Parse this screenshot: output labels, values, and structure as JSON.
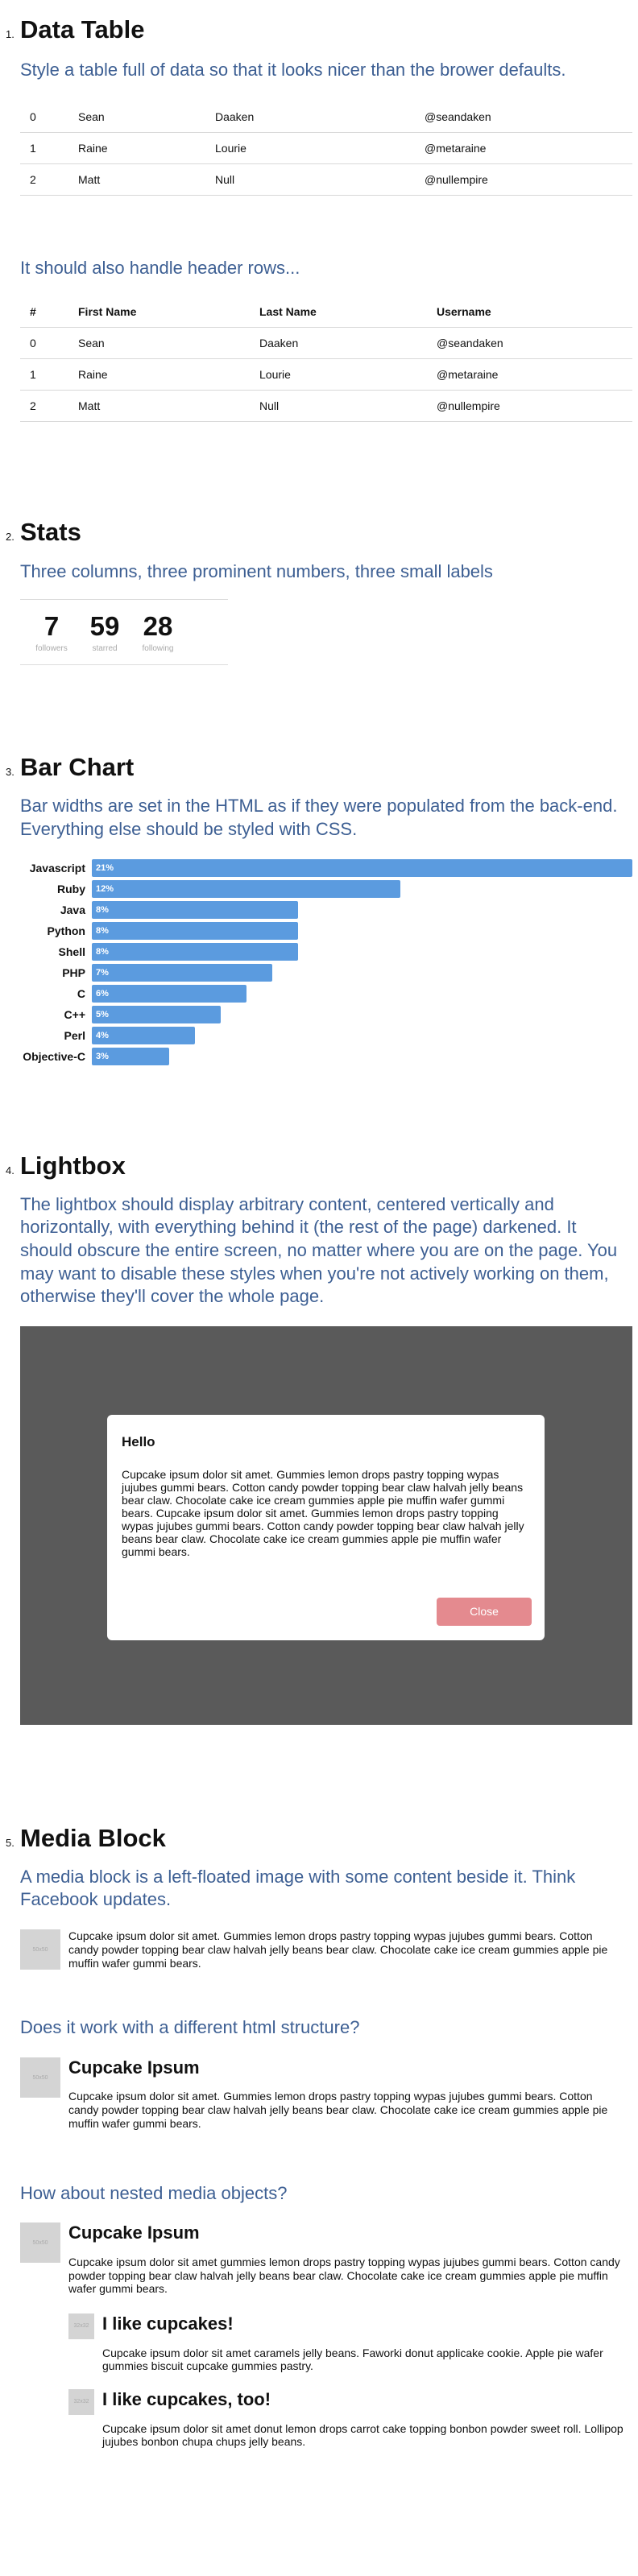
{
  "data_table": {
    "num": "1.",
    "title": "Data Table",
    "lead": "Style a table full of data so that it looks nicer than the brower defaults.",
    "rows": [
      [
        "0",
        "Sean",
        "Daaken",
        "@seandaken"
      ],
      [
        "1",
        "Raine",
        "Lourie",
        "@metaraine"
      ],
      [
        "2",
        "Matt",
        "Null",
        "@nullempire"
      ]
    ],
    "lead2": "It should also handle header rows...",
    "headers": [
      "#",
      "First Name",
      "Last Name",
      "Username"
    ]
  },
  "stats": {
    "num": "2.",
    "title": "Stats",
    "lead": "Three columns, three prominent numbers, three small labels",
    "items": [
      {
        "value": "7",
        "label": "followers"
      },
      {
        "value": "59",
        "label": "starred"
      },
      {
        "value": "28",
        "label": "following"
      }
    ]
  },
  "bar_chart": {
    "num": "3.",
    "title": "Bar Chart",
    "lead": "Bar widths are set in the HTML as if they were populated from the back-end. Everything else should be styled with CSS."
  },
  "chart_data": {
    "type": "bar",
    "orientation": "horizontal",
    "categories": [
      "Javascript",
      "Ruby",
      "Java",
      "Python",
      "Shell",
      "PHP",
      "C",
      "C++",
      "Perl",
      "Objective-C"
    ],
    "values": [
      21,
      12,
      8,
      8,
      8,
      7,
      6,
      5,
      4,
      3
    ],
    "labels": [
      "21%",
      "12%",
      "8%",
      "8%",
      "8%",
      "7%",
      "6%",
      "5%",
      "4%",
      "3%"
    ],
    "xlim": [
      0,
      21
    ],
    "color": "#5b9bdf"
  },
  "lightbox": {
    "num": "4.",
    "title": "Lightbox",
    "lead": "The lightbox should display arbitrary content, centered vertically and horizontally, with everything behind it (the rest of the page) darkened. It should obscure the entire screen, no matter where you are on the page. You may want to disable these styles when you're not actively working on them, otherwise they'll cover the whole page.",
    "modal_title": "Hello",
    "modal_text": "Cupcake ipsum dolor sit amet. Gummies lemon drops pastry topping wypas jujubes gummi bears. Cotton candy powder topping bear claw halvah jelly beans bear claw. Chocolate cake ice cream gummies apple pie muffin wafer gummi bears. Cupcake ipsum dolor sit amet. Gummies lemon drops pastry topping wypas jujubes gummi bears. Cotton candy powder topping bear claw halvah jelly beans bear claw. Chocolate cake ice cream gummies apple pie muffin wafer gummi bears.",
    "close_label": "Close"
  },
  "media_block": {
    "num": "5.",
    "title": "Media Block",
    "lead": "A media block is a left-floated image with some content beside it. Think Facebook updates.",
    "thumb_text": "50x50",
    "small_thumb_text": "32x32",
    "text1": "Cupcake ipsum dolor sit amet. Gummies lemon drops pastry topping wypas jujubes gummi bears. Cotton candy powder topping bear claw halvah jelly beans bear claw. Chocolate cake ice cream gummies apple pie muffin wafer gummi bears.",
    "lead2": "Does it work with a different html structure?",
    "heading2": "Cupcake Ipsum",
    "text2": "Cupcake ipsum dolor sit amet. Gummies lemon drops pastry topping wypas jujubes gummi bears. Cotton candy powder topping bear claw halvah jelly beans bear claw. Chocolate cake ice cream gummies apple pie muffin wafer gummi bears.",
    "lead3": "How about nested media objects?",
    "heading3": "Cupcake Ipsum",
    "text3": "Cupcake ipsum dolor sit amet gummies lemon drops pastry topping wypas jujubes gummi bears. Cotton candy powder topping bear claw halvah jelly beans bear claw. Chocolate cake ice cream gummies apple pie muffin wafer gummi bears.",
    "nested": [
      {
        "heading": "I like cupcakes!",
        "text": "Cupcake ipsum dolor sit amet caramels jelly beans. Faworki donut applicake cookie. Apple pie wafer gummies biscuit cupcake gummies pastry."
      },
      {
        "heading": "I like cupcakes, too!",
        "text": "Cupcake ipsum dolor sit amet donut lemon drops carrot cake topping bonbon powder sweet roll. Lollipop jujubes bonbon chupa chups jelly beans."
      }
    ]
  }
}
